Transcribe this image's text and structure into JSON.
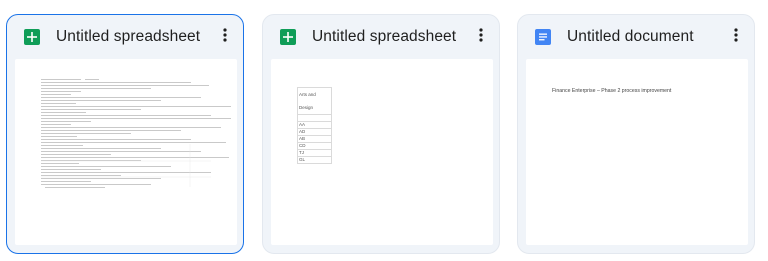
{
  "cards": [
    {
      "title": "Untitled spreadsheet",
      "file_type": "sheets",
      "icon": "sheets-icon",
      "selected": true
    },
    {
      "title": "Untitled spreadsheet",
      "file_type": "sheets",
      "icon": "sheets-icon",
      "selected": false,
      "preview_cells": [
        "Arts and Design",
        "AA",
        "AD",
        "AB",
        "CD",
        "TJ",
        "GL"
      ]
    },
    {
      "title": "Untitled document",
      "file_type": "docs",
      "icon": "docs-icon",
      "selected": false,
      "preview_text": "Finance Enterprise – Phase 2 process improvement"
    }
  ],
  "more_icon": "more-vertical-icon",
  "colors": {
    "card_bg": "#f0f4f9",
    "selected_border": "#1a73e8",
    "sheets_green": "#0f9d58",
    "docs_blue": "#4285f4"
  }
}
